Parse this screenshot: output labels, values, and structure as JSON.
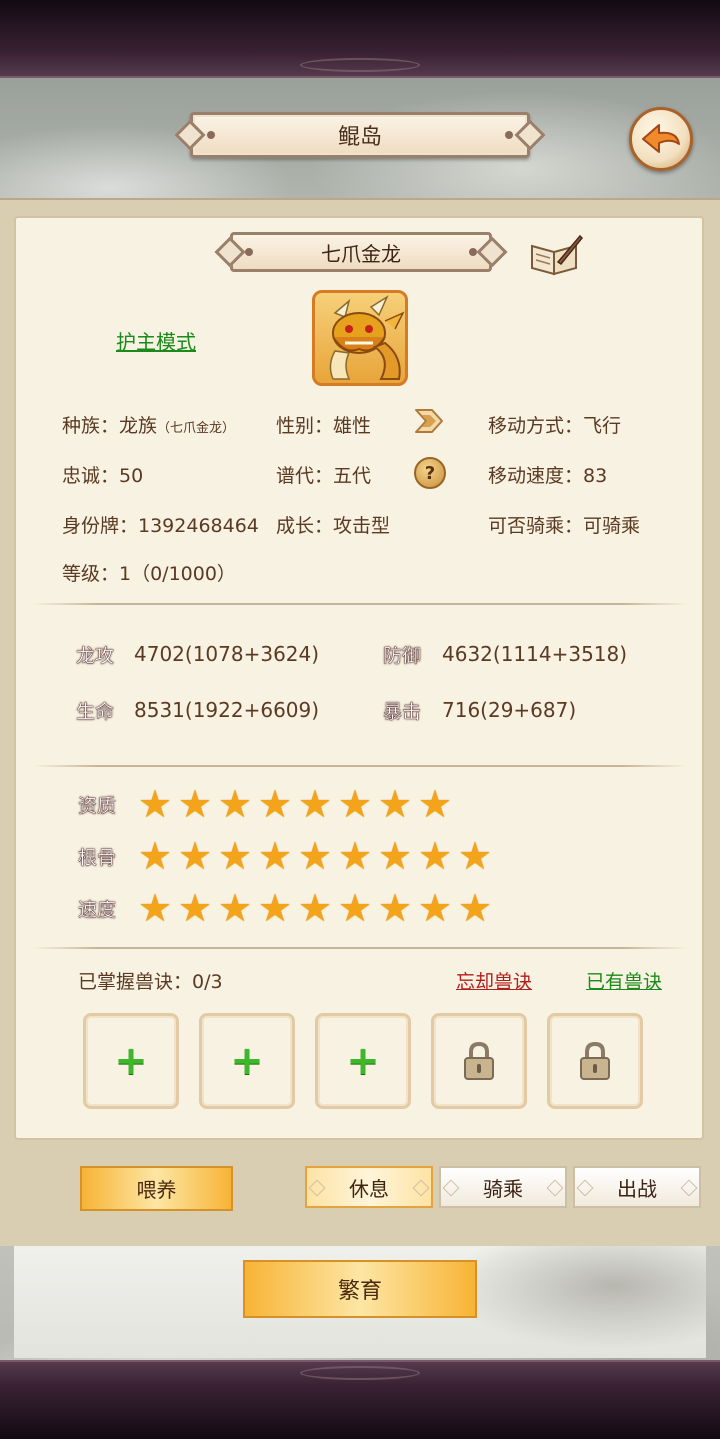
{
  "header": {
    "title": "鲲岛",
    "back_icon": "back-arrow-icon"
  },
  "pet": {
    "name": "七爪金龙",
    "guard_mode": "护主模式",
    "race_label": "种族：龙族",
    "race_sub": "（七爪金龙）",
    "gender": "性别：雄性",
    "move_type": "移动方式：飞行",
    "loyalty": "忠诚：50",
    "generation": "谱代：五代",
    "move_speed": "移动速度：83",
    "id_tag": "身份牌：1392468464",
    "growth": "成长：攻击型",
    "rideable": "可否骑乘：可骑乘",
    "level": "等级：1（0/1000）"
  },
  "stats": [
    {
      "badge": "龙攻",
      "value": "4702(1078+3624)"
    },
    {
      "badge": "防御",
      "value": "4632(1114+3518)"
    },
    {
      "badge": "生命",
      "value": "8531(1922+6609)"
    },
    {
      "badge": "暴击",
      "value": "716(29+687)"
    }
  ],
  "ratings": [
    {
      "badge": "资质",
      "stars": 8
    },
    {
      "badge": "根骨",
      "stars": 9
    },
    {
      "badge": "速度",
      "stars": 9
    }
  ],
  "skills": {
    "mastered": "已掌握兽诀：0/3",
    "forget": "忘却兽诀",
    "owned": "已有兽诀",
    "slots": [
      "add",
      "add",
      "add",
      "locked",
      "locked"
    ]
  },
  "actions": {
    "feed": "喂养",
    "rest": "休息",
    "ride": "骑乘",
    "battle": "出战",
    "breed": "繁育"
  },
  "colors": {
    "accent_gold": "#f7b436",
    "link_green": "#1a8a1a",
    "link_red": "#b21e1e",
    "stat_badge_red": "#b04a48",
    "rating_badge_teal": "#4a8a84"
  }
}
